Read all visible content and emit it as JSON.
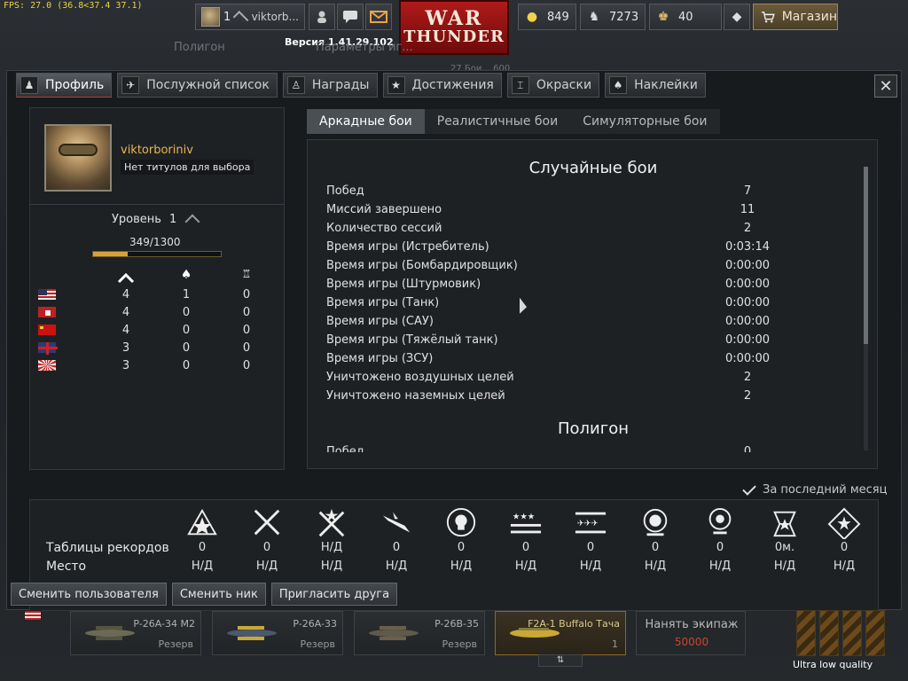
{
  "fps": "FPS: 27.0 (36.8<37.4 37.1)",
  "topbar": {
    "rank": "1",
    "username_short": "viktorb...",
    "logo_top": "WAR",
    "logo_bottom": "THUNDER",
    "research_points": "849",
    "silver_lions": "7273",
    "golden_eagles": "40",
    "shop_label": "Магазин"
  },
  "version": "Версия 1.41.29.102",
  "background_tabs": [
    "Полигон",
    "Параметры иг...",
    "27 Бои... 600"
  ],
  "tabs": [
    {
      "label": "Профиль",
      "icon": "profile-icon"
    },
    {
      "label": "Послужной список",
      "icon": "plane-icon"
    },
    {
      "label": "Награды",
      "icon": "medal-icon"
    },
    {
      "label": "Достижения",
      "icon": "star-icon"
    },
    {
      "label": "Окраски",
      "icon": "brush-icon"
    },
    {
      "label": "Наклейки",
      "icon": "spade-icon"
    }
  ],
  "profile": {
    "username": "viktorboriniv",
    "title": "Нет титулов для выбора",
    "level_label": "Уровень",
    "level": "1",
    "xp_text": "349/1300",
    "xp_progress": 0.268,
    "country_table": {
      "headers": [
        "rank-icon",
        "spade-icon",
        "medal-icon"
      ],
      "rows": [
        {
          "country": "USA",
          "values": [
            "4",
            "1",
            "0"
          ]
        },
        {
          "country": "Germany",
          "values": [
            "4",
            "0",
            "0"
          ]
        },
        {
          "country": "USSR",
          "values": [
            "4",
            "0",
            "0"
          ]
        },
        {
          "country": "Britain",
          "values": [
            "3",
            "0",
            "0"
          ]
        },
        {
          "country": "Japan",
          "values": [
            "3",
            "0",
            "0"
          ]
        }
      ]
    }
  },
  "modes": [
    "Аркадные бои",
    "Реалистичные бои",
    "Симуляторные бои"
  ],
  "stats": {
    "section1_title": "Случайные бои",
    "rows": [
      {
        "label": "Побед",
        "value": "7"
      },
      {
        "label": "Миссий завершено",
        "value": "11"
      },
      {
        "label": "Количество сессий",
        "value": "2"
      },
      {
        "label": "Время игры (Истребитель)",
        "value": "0:03:14"
      },
      {
        "label": "Время игры (Бомбардировщик)",
        "value": "0:00:00"
      },
      {
        "label": "Время игры (Штурмовик)",
        "value": "0:00:00"
      },
      {
        "label": "Время игры (Танк)",
        "value": "0:00:00"
      },
      {
        "label": "Время игры (САУ)",
        "value": "0:00:00"
      },
      {
        "label": "Время игры (Тяжёлый танк)",
        "value": "0:00:00"
      },
      {
        "label": "Время игры (ЗСУ)",
        "value": "0:00:00"
      },
      {
        "label": "Уничтожено воздушных целей",
        "value": "2"
      },
      {
        "label": "Уничтожено наземных целей",
        "value": "2"
      }
    ],
    "section2_title": "Полигон",
    "section2_row": {
      "label": "Побед",
      "value": "0"
    }
  },
  "last_month_label": "За последний месяц",
  "records": {
    "row1_label": "Таблицы рекордов",
    "row2_label": "Место",
    "columns": [
      {
        "icon": "star-chevron-icon",
        "value": "0",
        "place": "Н/Д"
      },
      {
        "icon": "crossed-swords-icon",
        "value": "0",
        "place": "Н/Д"
      },
      {
        "icon": "crossed-swords-star-icon",
        "value": "Н/Д",
        "place": "Н/Д"
      },
      {
        "icon": "plane-down-icon",
        "value": "0",
        "place": "Н/Д"
      },
      {
        "icon": "skull-icon",
        "value": "0",
        "place": "Н/Д"
      },
      {
        "icon": "stars-bars-icon",
        "value": "0",
        "place": "Н/Д"
      },
      {
        "icon": "planes-bars-icon",
        "value": "0",
        "place": "Н/Д"
      },
      {
        "icon": "lion-icon",
        "value": "0",
        "place": "Н/Д"
      },
      {
        "icon": "bulb-icon",
        "value": "0",
        "place": "Н/Д"
      },
      {
        "icon": "clock-star-icon",
        "value": "0м.",
        "place": "Н/Д"
      },
      {
        "icon": "diamond-star-icon",
        "value": "0",
        "place": "Н/Д"
      }
    ]
  },
  "bottom_buttons": [
    "Сменить пользователя",
    "Сменить ник",
    "Пригласить друга"
  ],
  "slots": [
    {
      "name": "P-26A-34 M2",
      "status": "Резерв"
    },
    {
      "name": "P-26A-33",
      "status": "Резерв"
    },
    {
      "name": "P-26B-35",
      "status": "Резерв"
    },
    {
      "name": "F2A-1 Buffalo Тача",
      "status": "1"
    }
  ],
  "crew": {
    "label": "Нанять экипаж",
    "cost": "50000"
  },
  "quality_label": "Ultra low quality"
}
